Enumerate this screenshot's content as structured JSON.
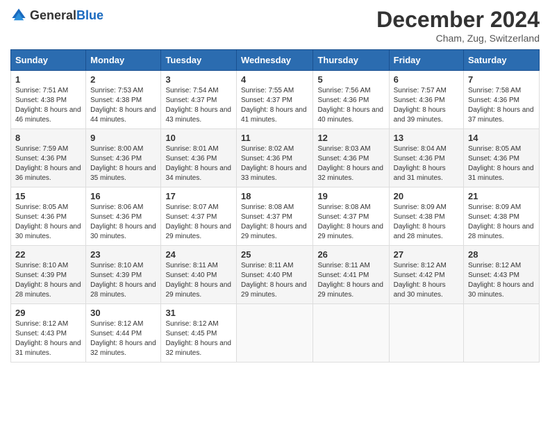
{
  "header": {
    "logo": {
      "general": "General",
      "blue": "Blue"
    },
    "title": "December 2024",
    "location": "Cham, Zug, Switzerland"
  },
  "days_of_week": [
    "Sunday",
    "Monday",
    "Tuesday",
    "Wednesday",
    "Thursday",
    "Friday",
    "Saturday"
  ],
  "weeks": [
    [
      {
        "day": "1",
        "sunrise": "7:51 AM",
        "sunset": "4:38 PM",
        "daylight": "8 hours and 46 minutes."
      },
      {
        "day": "2",
        "sunrise": "7:53 AM",
        "sunset": "4:38 PM",
        "daylight": "8 hours and 44 minutes."
      },
      {
        "day": "3",
        "sunrise": "7:54 AM",
        "sunset": "4:37 PM",
        "daylight": "8 hours and 43 minutes."
      },
      {
        "day": "4",
        "sunrise": "7:55 AM",
        "sunset": "4:37 PM",
        "daylight": "8 hours and 41 minutes."
      },
      {
        "day": "5",
        "sunrise": "7:56 AM",
        "sunset": "4:36 PM",
        "daylight": "8 hours and 40 minutes."
      },
      {
        "day": "6",
        "sunrise": "7:57 AM",
        "sunset": "4:36 PM",
        "daylight": "8 hours and 39 minutes."
      },
      {
        "day": "7",
        "sunrise": "7:58 AM",
        "sunset": "4:36 PM",
        "daylight": "8 hours and 37 minutes."
      }
    ],
    [
      {
        "day": "8",
        "sunrise": "7:59 AM",
        "sunset": "4:36 PM",
        "daylight": "8 hours and 36 minutes."
      },
      {
        "day": "9",
        "sunrise": "8:00 AM",
        "sunset": "4:36 PM",
        "daylight": "8 hours and 35 minutes."
      },
      {
        "day": "10",
        "sunrise": "8:01 AM",
        "sunset": "4:36 PM",
        "daylight": "8 hours and 34 minutes."
      },
      {
        "day": "11",
        "sunrise": "8:02 AM",
        "sunset": "4:36 PM",
        "daylight": "8 hours and 33 minutes."
      },
      {
        "day": "12",
        "sunrise": "8:03 AM",
        "sunset": "4:36 PM",
        "daylight": "8 hours and 32 minutes."
      },
      {
        "day": "13",
        "sunrise": "8:04 AM",
        "sunset": "4:36 PM",
        "daylight": "8 hours and 31 minutes."
      },
      {
        "day": "14",
        "sunrise": "8:05 AM",
        "sunset": "4:36 PM",
        "daylight": "8 hours and 31 minutes."
      }
    ],
    [
      {
        "day": "15",
        "sunrise": "8:05 AM",
        "sunset": "4:36 PM",
        "daylight": "8 hours and 30 minutes."
      },
      {
        "day": "16",
        "sunrise": "8:06 AM",
        "sunset": "4:36 PM",
        "daylight": "8 hours and 30 minutes."
      },
      {
        "day": "17",
        "sunrise": "8:07 AM",
        "sunset": "4:37 PM",
        "daylight": "8 hours and 29 minutes."
      },
      {
        "day": "18",
        "sunrise": "8:08 AM",
        "sunset": "4:37 PM",
        "daylight": "8 hours and 29 minutes."
      },
      {
        "day": "19",
        "sunrise": "8:08 AM",
        "sunset": "4:37 PM",
        "daylight": "8 hours and 29 minutes."
      },
      {
        "day": "20",
        "sunrise": "8:09 AM",
        "sunset": "4:38 PM",
        "daylight": "8 hours and 28 minutes."
      },
      {
        "day": "21",
        "sunrise": "8:09 AM",
        "sunset": "4:38 PM",
        "daylight": "8 hours and 28 minutes."
      }
    ],
    [
      {
        "day": "22",
        "sunrise": "8:10 AM",
        "sunset": "4:39 PM",
        "daylight": "8 hours and 28 minutes."
      },
      {
        "day": "23",
        "sunrise": "8:10 AM",
        "sunset": "4:39 PM",
        "daylight": "8 hours and 28 minutes."
      },
      {
        "day": "24",
        "sunrise": "8:11 AM",
        "sunset": "4:40 PM",
        "daylight": "8 hours and 29 minutes."
      },
      {
        "day": "25",
        "sunrise": "8:11 AM",
        "sunset": "4:40 PM",
        "daylight": "8 hours and 29 minutes."
      },
      {
        "day": "26",
        "sunrise": "8:11 AM",
        "sunset": "4:41 PM",
        "daylight": "8 hours and 29 minutes."
      },
      {
        "day": "27",
        "sunrise": "8:12 AM",
        "sunset": "4:42 PM",
        "daylight": "8 hours and 30 minutes."
      },
      {
        "day": "28",
        "sunrise": "8:12 AM",
        "sunset": "4:43 PM",
        "daylight": "8 hours and 30 minutes."
      }
    ],
    [
      {
        "day": "29",
        "sunrise": "8:12 AM",
        "sunset": "4:43 PM",
        "daylight": "8 hours and 31 minutes."
      },
      {
        "day": "30",
        "sunrise": "8:12 AM",
        "sunset": "4:44 PM",
        "daylight": "8 hours and 32 minutes."
      },
      {
        "day": "31",
        "sunrise": "8:12 AM",
        "sunset": "4:45 PM",
        "daylight": "8 hours and 32 minutes."
      },
      null,
      null,
      null,
      null
    ]
  ],
  "labels": {
    "sunrise": "Sunrise:",
    "sunset": "Sunset:",
    "daylight": "Daylight:"
  }
}
